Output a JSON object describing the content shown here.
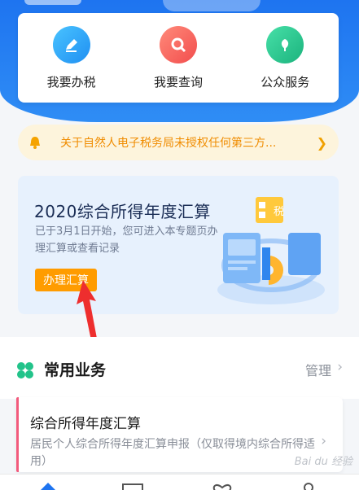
{
  "services": [
    {
      "label": "我要办税",
      "icon": "pencil-icon"
    },
    {
      "label": "我要查询",
      "icon": "search-icon"
    },
    {
      "label": "公众服务",
      "icon": "leaf-icon"
    }
  ],
  "notice": {
    "text": "关于自然人电子税务局未授权任何第三方...",
    "icon": "bell-icon"
  },
  "promo": {
    "title": "2020综合所得年度汇算",
    "desc": "已于3月1日开始，您可进入本专题页办理汇算或查看记录",
    "button": "办理汇算",
    "illus_badge": "税"
  },
  "common": {
    "title": "常用业务",
    "manage": "管理"
  },
  "business": {
    "name": "综合所得年度汇算",
    "desc": "居民个人综合所得年度汇算申报（仅取得境内综合所得适用）"
  },
  "watermark": "Bai du 经验",
  "colors": {
    "primary": "#1e74f0",
    "accent": "#ff9c00",
    "notice": "#f08c00",
    "business_bar": "#f25a7c"
  }
}
